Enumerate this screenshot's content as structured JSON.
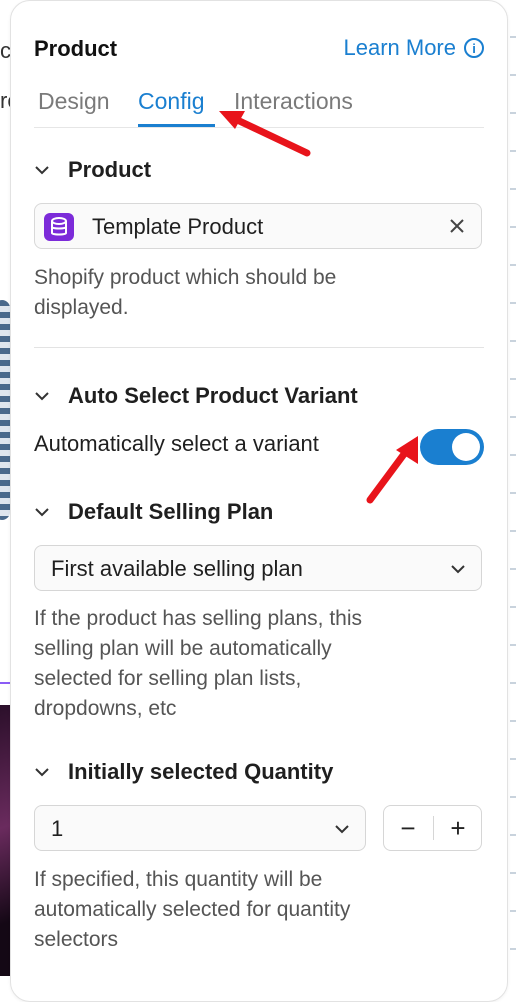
{
  "background": {
    "text_top": "ct",
    "text_mid": "rc"
  },
  "panel": {
    "title": "Product",
    "learn_more": "Learn More",
    "info_icon": "info-icon"
  },
  "tabs": [
    {
      "label": "Design",
      "active": false
    },
    {
      "label": "Config",
      "active": true
    },
    {
      "label": "Interactions",
      "active": false
    }
  ],
  "product_section": {
    "heading": "Product",
    "field_value": "Template Product",
    "field_icon": "database-icon",
    "clear_icon": "close-icon",
    "help_line1": "Shopify product which should be",
    "help_line2": "displayed."
  },
  "auto_select_section": {
    "heading": "Auto Select Product Variant",
    "toggle_label": "Automatically select a variant",
    "toggle_on": true
  },
  "selling_plan_section": {
    "heading": "Default Selling Plan",
    "selected": "First available selling plan",
    "help_line1": "If the product has selling plans, this",
    "help_line2": "selling plan will be automatically",
    "help_line3": "selected for selling plan lists,",
    "help_line4": "dropdowns, etc"
  },
  "quantity_section": {
    "heading": "Initially selected Quantity",
    "selected": "1",
    "minus": "−",
    "plus": "+",
    "help_line1": "If specified, this quantity will be",
    "help_line2": "automatically selected for quantity",
    "help_line3": "selectors"
  },
  "colors": {
    "accent": "#1a7fd0",
    "annotation_arrow": "#e8141b",
    "db_icon_bg": "#7c2bd9"
  }
}
